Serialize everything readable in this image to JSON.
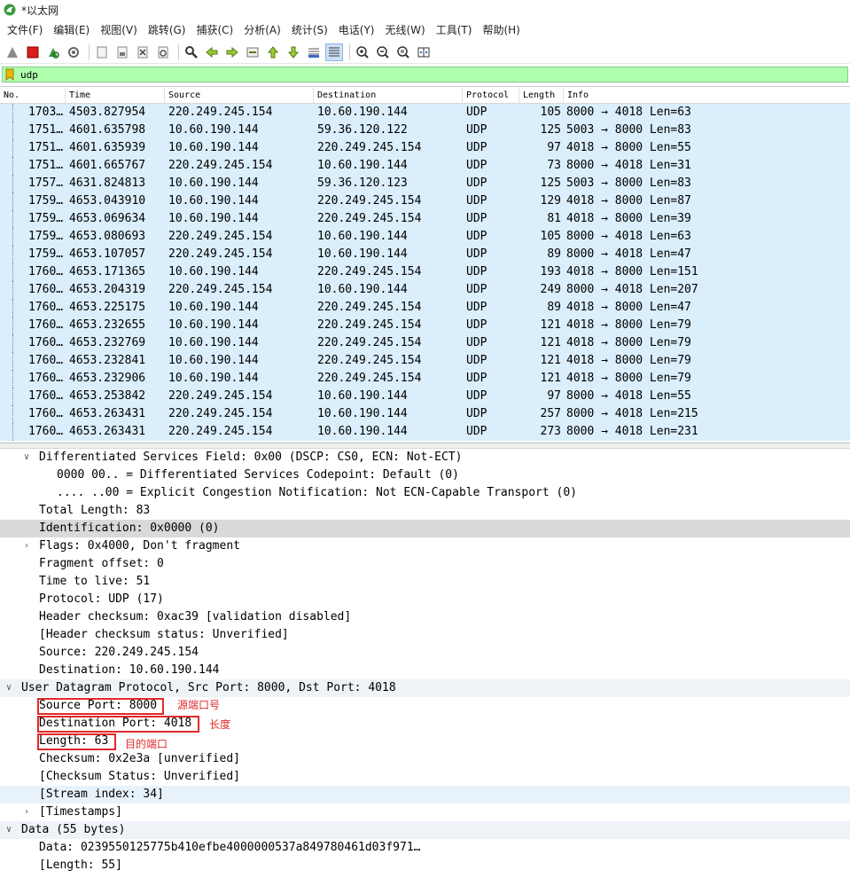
{
  "window": {
    "title": "*以太网"
  },
  "menu": [
    "文件(F)",
    "编辑(E)",
    "视图(V)",
    "跳转(G)",
    "捕获(C)",
    "分析(A)",
    "统计(S)",
    "电话(Y)",
    "无线(W)",
    "工具(T)",
    "帮助(H)"
  ],
  "filter": {
    "value": "udp"
  },
  "packet_list": {
    "columns": [
      "No.",
      "Time",
      "Source",
      "Destination",
      "Protocol",
      "Length",
      "Info"
    ],
    "rows": [
      {
        "no": "1703…",
        "time": "4503.827954",
        "src": "220.249.245.154",
        "dst": "10.60.190.144",
        "proto": "UDP",
        "len": "105",
        "info": "8000 → 4018 Len=63"
      },
      {
        "no": "1751…",
        "time": "4601.635798",
        "src": "10.60.190.144",
        "dst": "59.36.120.122",
        "proto": "UDP",
        "len": "125",
        "info": "5003 → 8000 Len=83"
      },
      {
        "no": "1751…",
        "time": "4601.635939",
        "src": "10.60.190.144",
        "dst": "220.249.245.154",
        "proto": "UDP",
        "len": "97",
        "info": "4018 → 8000 Len=55"
      },
      {
        "no": "1751…",
        "time": "4601.665767",
        "src": "220.249.245.154",
        "dst": "10.60.190.144",
        "proto": "UDP",
        "len": "73",
        "info": "8000 → 4018 Len=31"
      },
      {
        "no": "1757…",
        "time": "4631.824813",
        "src": "10.60.190.144",
        "dst": "59.36.120.123",
        "proto": "UDP",
        "len": "125",
        "info": "5003 → 8000 Len=83"
      },
      {
        "no": "1759…",
        "time": "4653.043910",
        "src": "10.60.190.144",
        "dst": "220.249.245.154",
        "proto": "UDP",
        "len": "129",
        "info": "4018 → 8000 Len=87"
      },
      {
        "no": "1759…",
        "time": "4653.069634",
        "src": "10.60.190.144",
        "dst": "220.249.245.154",
        "proto": "UDP",
        "len": "81",
        "info": "4018 → 8000 Len=39"
      },
      {
        "no": "1759…",
        "time": "4653.080693",
        "src": "220.249.245.154",
        "dst": "10.60.190.144",
        "proto": "UDP",
        "len": "105",
        "info": "8000 → 4018 Len=63"
      },
      {
        "no": "1759…",
        "time": "4653.107057",
        "src": "220.249.245.154",
        "dst": "10.60.190.144",
        "proto": "UDP",
        "len": "89",
        "info": "8000 → 4018 Len=47"
      },
      {
        "no": "1760…",
        "time": "4653.171365",
        "src": "10.60.190.144",
        "dst": "220.249.245.154",
        "proto": "UDP",
        "len": "193",
        "info": "4018 → 8000 Len=151"
      },
      {
        "no": "1760…",
        "time": "4653.204319",
        "src": "220.249.245.154",
        "dst": "10.60.190.144",
        "proto": "UDP",
        "len": "249",
        "info": "8000 → 4018 Len=207"
      },
      {
        "no": "1760…",
        "time": "4653.225175",
        "src": "10.60.190.144",
        "dst": "220.249.245.154",
        "proto": "UDP",
        "len": "89",
        "info": "4018 → 8000 Len=47"
      },
      {
        "no": "1760…",
        "time": "4653.232655",
        "src": "10.60.190.144",
        "dst": "220.249.245.154",
        "proto": "UDP",
        "len": "121",
        "info": "4018 → 8000 Len=79"
      },
      {
        "no": "1760…",
        "time": "4653.232769",
        "src": "10.60.190.144",
        "dst": "220.249.245.154",
        "proto": "UDP",
        "len": "121",
        "info": "4018 → 8000 Len=79"
      },
      {
        "no": "1760…",
        "time": "4653.232841",
        "src": "10.60.190.144",
        "dst": "220.249.245.154",
        "proto": "UDP",
        "len": "121",
        "info": "4018 → 8000 Len=79"
      },
      {
        "no": "1760…",
        "time": "4653.232906",
        "src": "10.60.190.144",
        "dst": "220.249.245.154",
        "proto": "UDP",
        "len": "121",
        "info": "4018 → 8000 Len=79"
      },
      {
        "no": "1760…",
        "time": "4653.253842",
        "src": "220.249.245.154",
        "dst": "10.60.190.144",
        "proto": "UDP",
        "len": "97",
        "info": "8000 → 4018 Len=55"
      },
      {
        "no": "1760…",
        "time": "4653.263431",
        "src": "220.249.245.154",
        "dst": "10.60.190.144",
        "proto": "UDP",
        "len": "257",
        "info": "8000 → 4018 Len=215"
      },
      {
        "no": "1760…",
        "time": "4653.263431",
        "src": "220.249.245.154",
        "dst": "10.60.190.144",
        "proto": "UDP",
        "len": "273",
        "info": "8000 → 4018 Len=231"
      }
    ]
  },
  "details": [
    {
      "text": "Differentiated Services Field: 0x00 (DSCP: CS0, ECN: Not-ECT)",
      "indent": 1,
      "toggle": "expanded",
      "hl": ""
    },
    {
      "text": "0000 00.. = Differentiated Services Codepoint: Default (0)",
      "indent": 2,
      "toggle": "",
      "hl": ""
    },
    {
      "text": ".... ..00 = Explicit Congestion Notification: Not ECN-Capable Transport (0)",
      "indent": 2,
      "toggle": "",
      "hl": ""
    },
    {
      "text": "Total Length: 83",
      "indent": 1,
      "toggle": "",
      "hl": ""
    },
    {
      "text": "Identification: 0x0000 (0)",
      "indent": 1,
      "toggle": "",
      "hl": "gray"
    },
    {
      "text": "Flags: 0x4000, Don't fragment",
      "indent": 1,
      "toggle": "collapsed",
      "hl": ""
    },
    {
      "text": "Fragment offset: 0",
      "indent": 1,
      "toggle": "",
      "hl": ""
    },
    {
      "text": "Time to live: 51",
      "indent": 1,
      "toggle": "",
      "hl": ""
    },
    {
      "text": "Protocol: UDP (17)",
      "indent": 1,
      "toggle": "",
      "hl": ""
    },
    {
      "text": "Header checksum: 0xac39 [validation disabled]",
      "indent": 1,
      "toggle": "",
      "hl": ""
    },
    {
      "text": "[Header checksum status: Unverified]",
      "indent": 1,
      "toggle": "",
      "hl": ""
    },
    {
      "text": "Source: 220.249.245.154",
      "indent": 1,
      "toggle": "",
      "hl": ""
    },
    {
      "text": "Destination: 10.60.190.144",
      "indent": 1,
      "toggle": "",
      "hl": ""
    },
    {
      "text": "User Datagram Protocol, Src Port: 8000, Dst Port: 4018",
      "indent": 0,
      "toggle": "expanded",
      "hl": "light"
    },
    {
      "text": "Source Port: 8000",
      "indent": 1,
      "toggle": "",
      "hl": ""
    },
    {
      "text": "Destination Port: 4018",
      "indent": 1,
      "toggle": "",
      "hl": ""
    },
    {
      "text": "Length: 63",
      "indent": 1,
      "toggle": "",
      "hl": ""
    },
    {
      "text": "Checksum: 0x2e3a [unverified]",
      "indent": 1,
      "toggle": "",
      "hl": ""
    },
    {
      "text": "[Checksum Status: Unverified]",
      "indent": 1,
      "toggle": "",
      "hl": ""
    },
    {
      "text": "[Stream index: 34]",
      "indent": 1,
      "toggle": "",
      "hl": "blue"
    },
    {
      "text": "[Timestamps]",
      "indent": 1,
      "toggle": "collapsed",
      "hl": ""
    },
    {
      "text": "Data (55 bytes)",
      "indent": 0,
      "toggle": "expanded",
      "hl": "light"
    },
    {
      "text": "Data: 0239550125775b410efbe4000000537a849780461d03f971…",
      "indent": 1,
      "toggle": "",
      "hl": ""
    },
    {
      "text": "[Length: 55]",
      "indent": 1,
      "toggle": "",
      "hl": ""
    }
  ],
  "annotations": {
    "source_port": "源端口号",
    "dest_port": "长度",
    "length": "目的端口"
  },
  "colors": {
    "row_bg": "#daeefb",
    "filter_bg": "#afffaf",
    "annotation": "#e02a2a"
  }
}
